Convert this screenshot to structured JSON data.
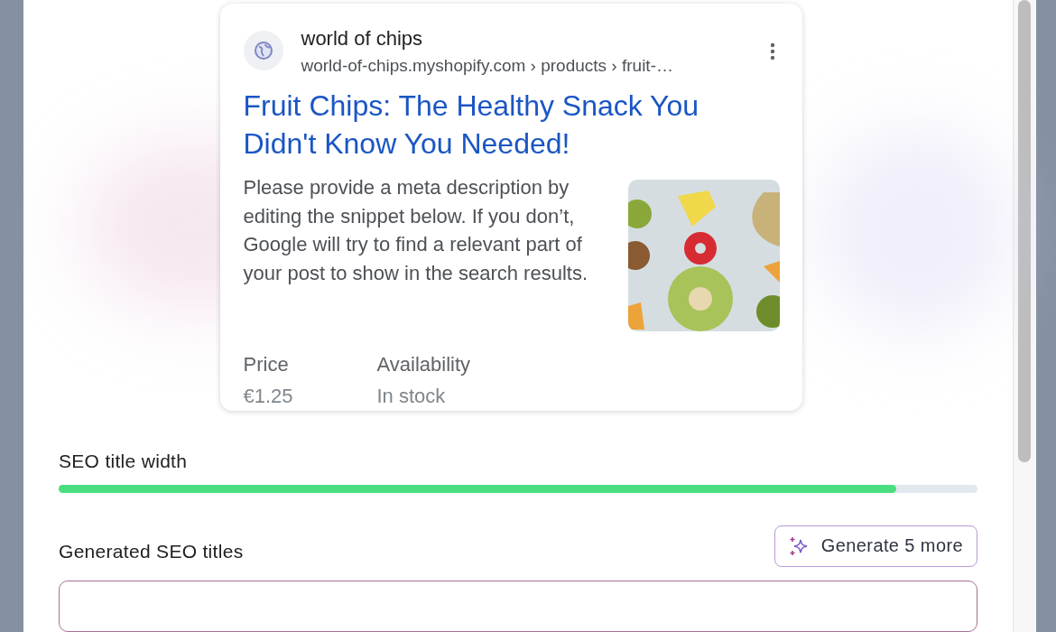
{
  "preview": {
    "site_name": "world of chips",
    "breadcrumb": "world-of-chips.myshopify.com › products › fruit-…",
    "title": "Fruit Chips: The Healthy Snack You Didn't Know You Needed!",
    "description": "Please provide a meta description by editing the snippet below. If you don’t, Google will try to find a relevant part of your post to show in the search results.",
    "facts": [
      {
        "label": "Price",
        "value": "€1.25"
      },
      {
        "label": "Availability",
        "value": "In stock"
      }
    ]
  },
  "title_width": {
    "label": "SEO title width",
    "level": 0.912
  },
  "generated": {
    "heading": "Generated SEO titles",
    "button": "Generate 5 more"
  }
}
